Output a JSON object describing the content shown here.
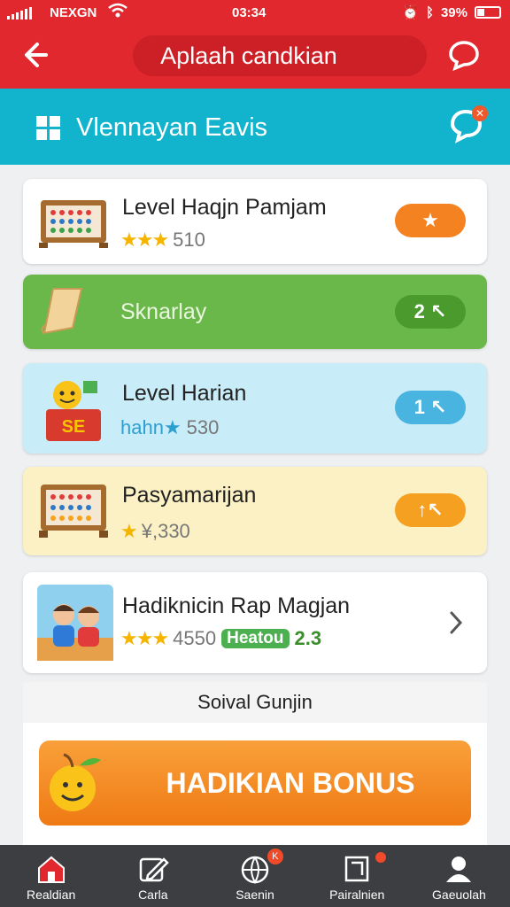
{
  "status": {
    "carrier": "NEXGN",
    "time": "03:34",
    "battery": "39%"
  },
  "header": {
    "title": "Aplaah candkian",
    "back_icon": "back-arrow-icon",
    "right_icon": "chat-bubble-icon"
  },
  "subheader": {
    "title": "Vlennayan Eavis",
    "left_icon": "grid-icon",
    "right_icon": "chat-badge-icon"
  },
  "cards": [
    {
      "title": "Level Haqjn Pamjam",
      "rating": "★★★",
      "value": "510",
      "pill": "★",
      "pill_color": "#f58220"
    },
    {
      "title": "Sknarlay",
      "rating": "",
      "value": "",
      "pill": "2 ↖",
      "pill_color": "#4a9a2e"
    },
    {
      "title": "Level Harian",
      "rating": "hahn★",
      "value": "530",
      "pill": "1 ↖",
      "pill_color": "#4ab4e0"
    },
    {
      "title": "Pasyamarijan",
      "rating": "★",
      "value": "¥,330",
      "pill": "↑↖",
      "pill_color": "#f5a021"
    },
    {
      "title": "Hadiknicin Rap Magjan",
      "rating": "★★★",
      "value": "4550",
      "tag": "Heatou",
      "tag_value": "2.3"
    }
  ],
  "section_title": "Soival Gunjin",
  "bonus_button": "HADIKIAN BONUS",
  "nav": [
    {
      "label": "Realdian",
      "icon": "home-icon",
      "active": true
    },
    {
      "label": "Carla",
      "icon": "edit-icon"
    },
    {
      "label": "Saenin",
      "icon": "globe-icon",
      "badge": "K"
    },
    {
      "label": "Pairalnien",
      "icon": "window-icon",
      "badge": ""
    },
    {
      "label": "Gaeuolah",
      "icon": "user-icon"
    }
  ],
  "colors": {
    "header_red": "#e0282e",
    "subheader_teal": "#12b3cc",
    "nav_dark": "#3c3e41",
    "bonus_orange": "#f58a22"
  }
}
